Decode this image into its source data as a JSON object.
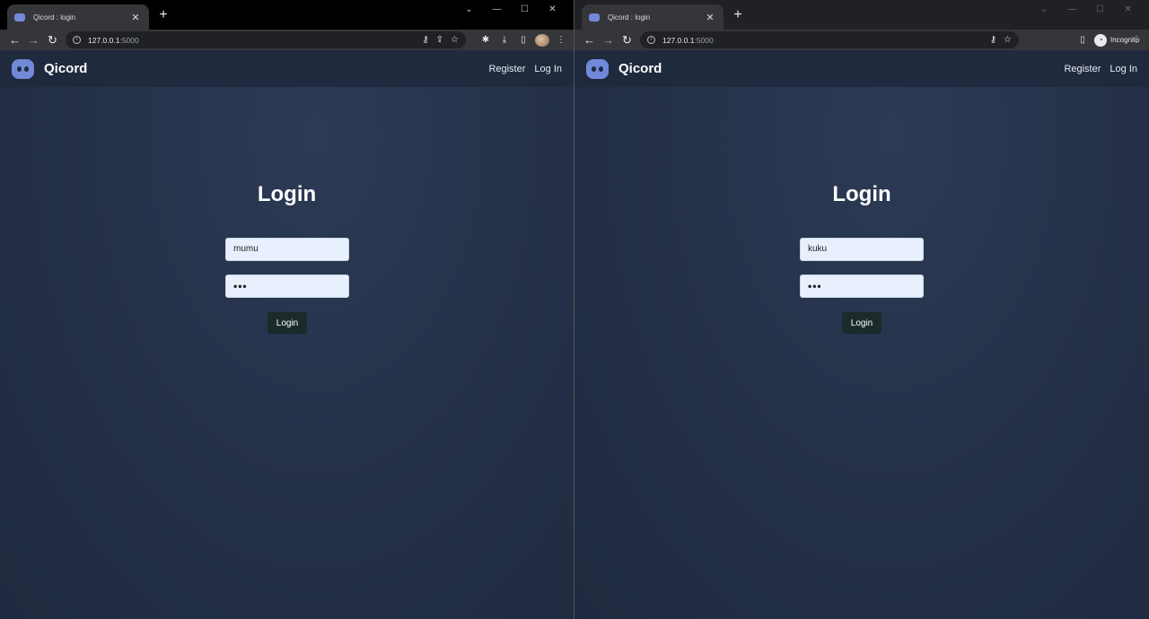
{
  "left": {
    "tab_title": "Qicord : login",
    "tab_close": "✕",
    "new_tab": "+",
    "url_host": "127.0.0.1",
    "url_port": ":5000",
    "brand": "Qicord",
    "nav": {
      "register": "Register",
      "login": "Log In"
    },
    "title": "Login",
    "username_value": "mumu",
    "password_value": "•••",
    "login_button": "Login"
  },
  "right": {
    "tab_title": "Qicord : login",
    "tab_close": "✕",
    "new_tab": "+",
    "url_host": "127.0.0.1",
    "url_port": ":5000",
    "incognito_label": "Incognito",
    "brand": "Qicord",
    "nav": {
      "register": "Register",
      "login": "Log In"
    },
    "title": "Login",
    "username_value": "kuku",
    "password_value": "•••",
    "login_button": "Login"
  },
  "icons": {
    "back": "←",
    "forward": "→",
    "reload": "↻",
    "key": "⚷",
    "share": "⇪",
    "star": "☆",
    "extensions": "✱",
    "download": "⤓",
    "sidepanel": "▯",
    "menu": "⋮",
    "minimize": "—",
    "maximize": "☐",
    "close": "✕",
    "chevron": "⌄"
  },
  "colors": {
    "brand": "#7289da",
    "page_bg": "#26324a",
    "nav_bg": "#1f2a3e",
    "button_bg": "#1b2a2a",
    "input_bg": "#e8f0fe"
  }
}
